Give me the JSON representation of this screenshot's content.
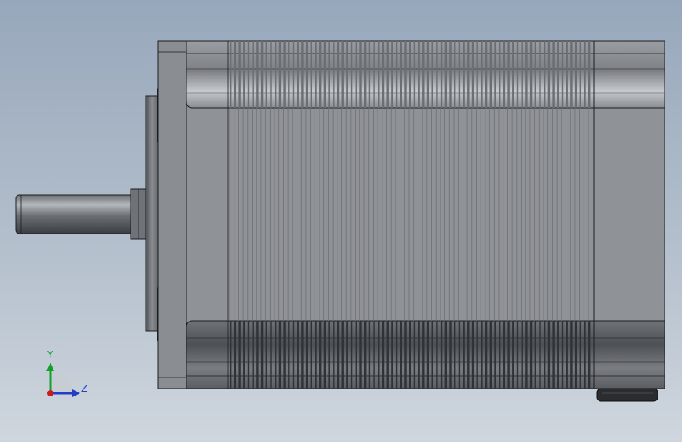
{
  "scene": {
    "model": "stepper-motor-side-view",
    "view": "side"
  },
  "colors": {
    "body": "#8f9296",
    "body_dark": "#3e4145",
    "outline": "#1c1e21",
    "highlight": "#c9cdd1",
    "axis_y": "#11a12b",
    "axis_z": "#1f3fc9",
    "axis_x": "#d01a1a"
  },
  "triad": {
    "y_label": "Y",
    "z_label": "Z"
  }
}
